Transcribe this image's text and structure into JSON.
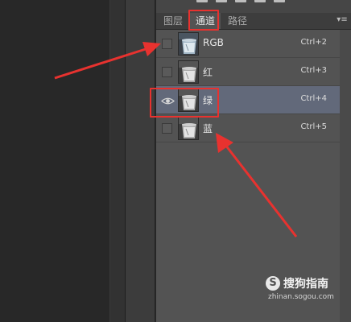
{
  "tabs": [
    {
      "label": "图层",
      "active": false
    },
    {
      "label": "通道",
      "active": true
    },
    {
      "label": "路径",
      "active": false
    }
  ],
  "panel_menu_icon": "panel-menu-icon",
  "channels": [
    {
      "name": "RGB",
      "shortcut": "Ctrl+2",
      "visible": false,
      "selected": false
    },
    {
      "name": "红",
      "shortcut": "Ctrl+3",
      "visible": false,
      "selected": false
    },
    {
      "name": "绿",
      "shortcut": "Ctrl+4",
      "visible": true,
      "selected": true
    },
    {
      "name": "蓝",
      "shortcut": "Ctrl+5",
      "visible": false,
      "selected": false
    }
  ],
  "annotation_color": "#e8322f",
  "selection_color": "#62697a",
  "watermark": {
    "logo_char": "S",
    "title": "搜狗指南",
    "url": "zhinan.sogou.com"
  }
}
